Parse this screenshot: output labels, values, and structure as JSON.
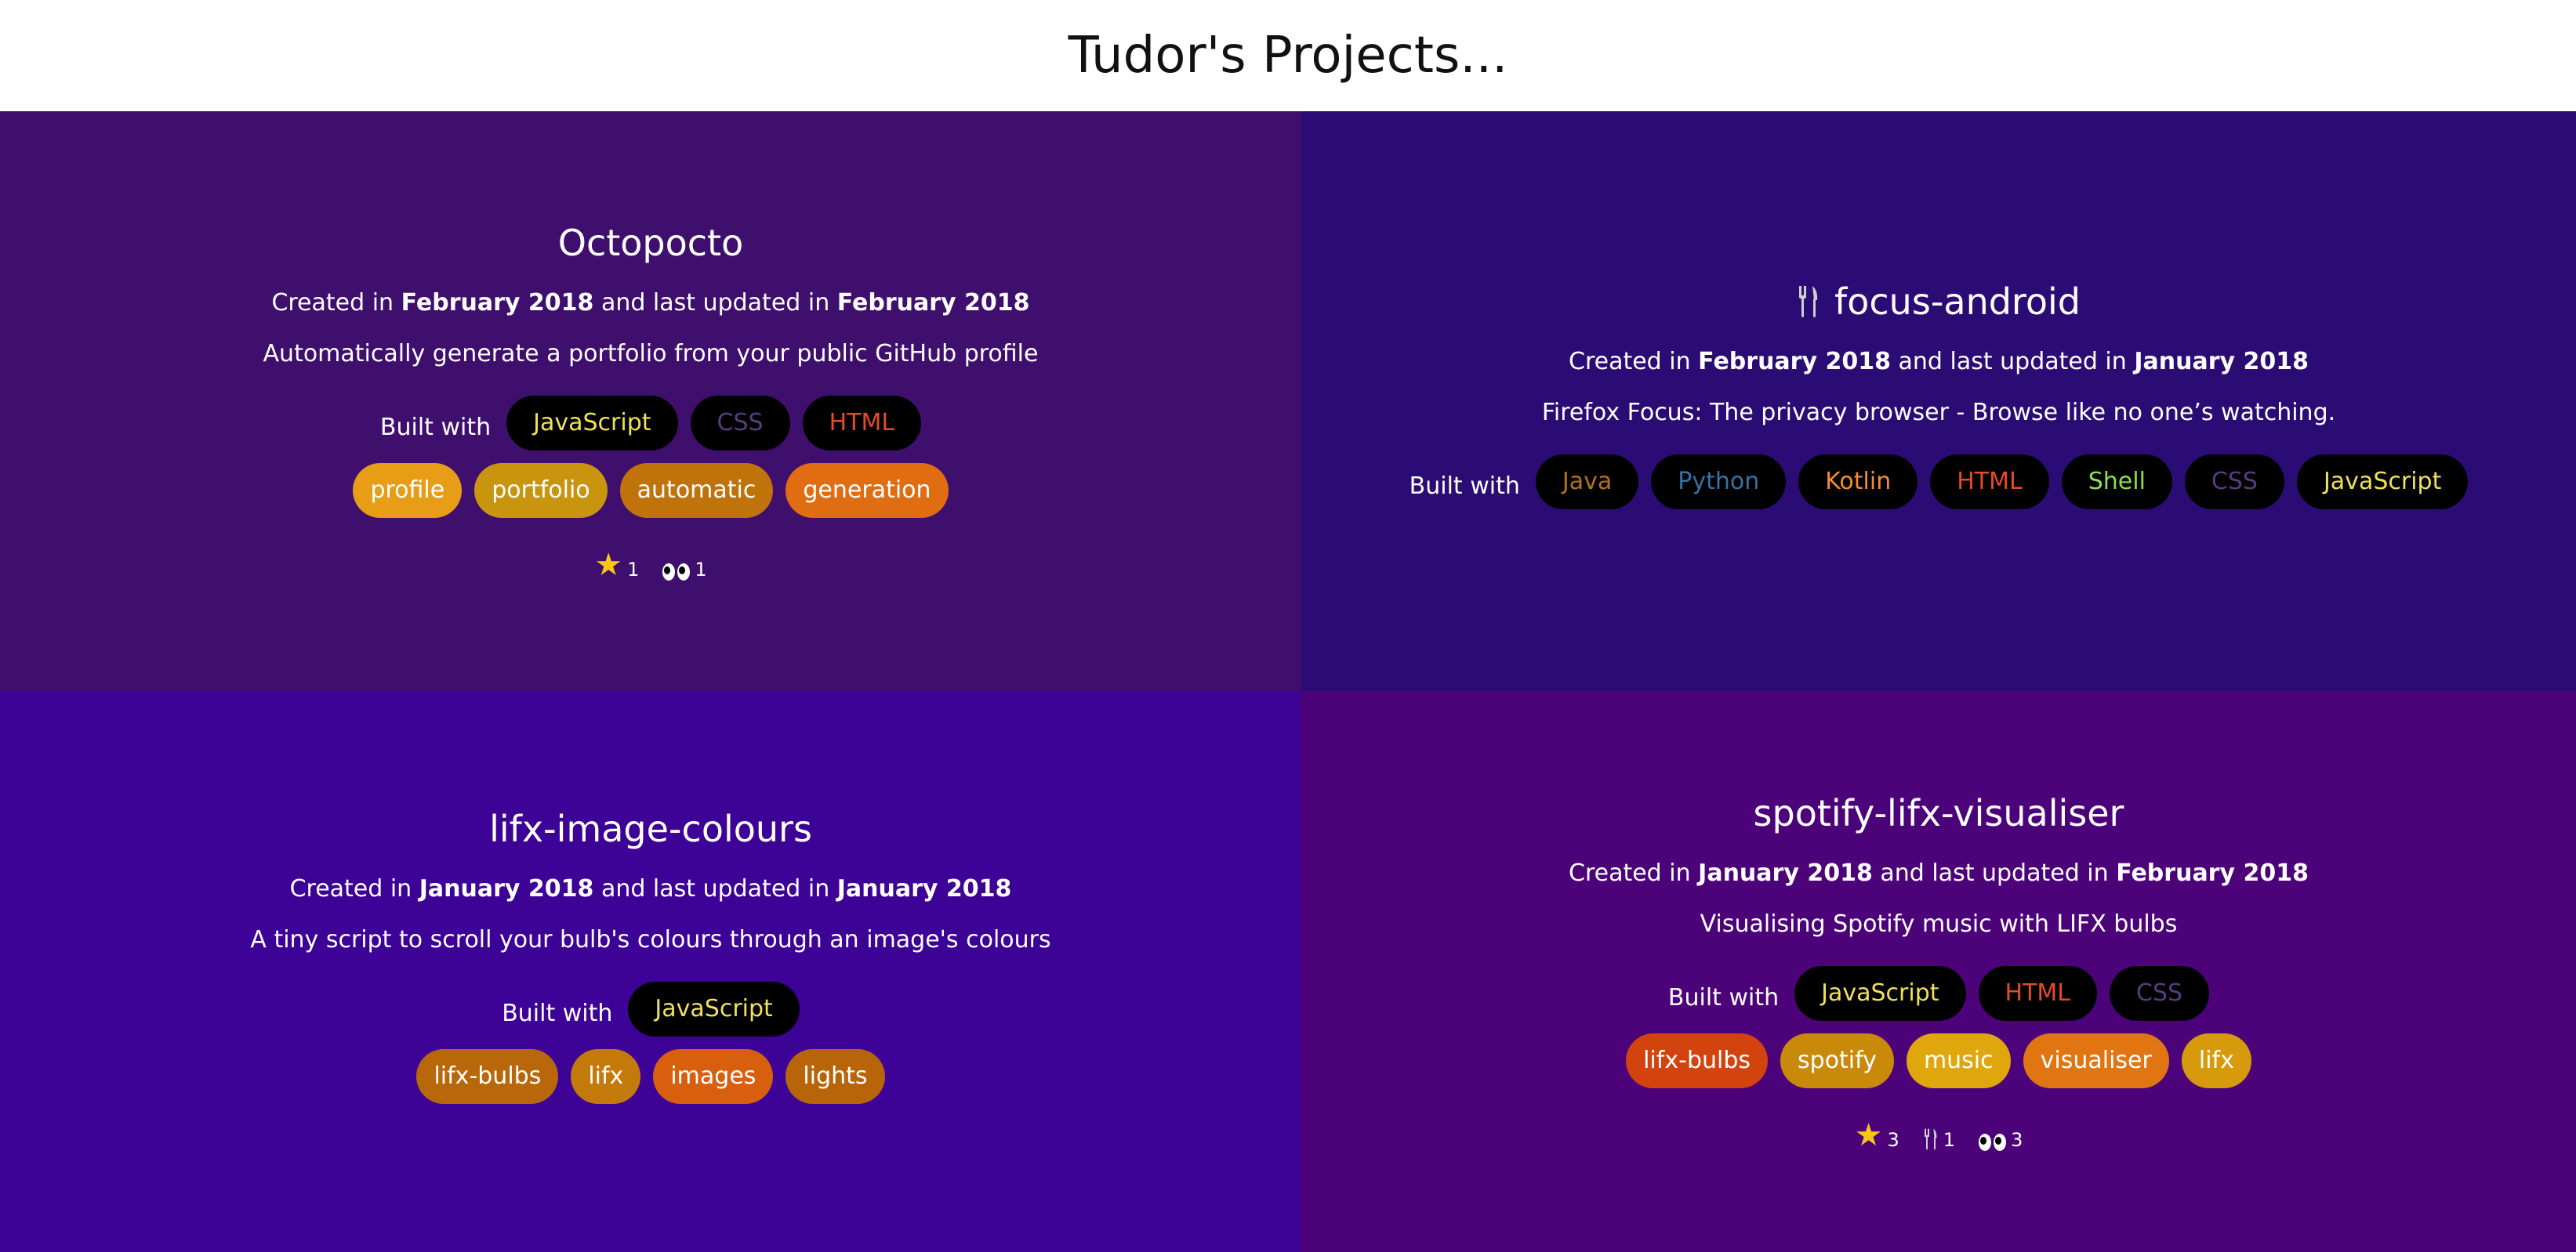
{
  "page": {
    "title": "Tudor's Projects..."
  },
  "built_with_label": "Built with",
  "colors": {
    "card_bg": [
      "#3f0f6e",
      "#2b0c75",
      "#3d0296",
      "#4c037a"
    ]
  },
  "projects": [
    {
      "title": "Octopocto",
      "has_fork_icon": false,
      "created_prefix": "Created in",
      "created": "February 2018",
      "updated_prefix": "and last updated in",
      "updated": "February 2018",
      "description": "Automatically generate a portfolio from your public GitHub profile",
      "languages": [
        {
          "name": "JavaScript",
          "color": "#f1e05a"
        },
        {
          "name": "CSS",
          "color": "#563d7c"
        },
        {
          "name": "HTML",
          "color": "#e34c26"
        }
      ],
      "topics": [
        {
          "name": "profile",
          "bg": "#e89d17"
        },
        {
          "name": "portfolio",
          "bg": "#c9950f"
        },
        {
          "name": "automatic",
          "bg": "#c0720b"
        },
        {
          "name": "generation",
          "bg": "#e06d12"
        }
      ],
      "stats": {
        "stars": "1",
        "forks": null,
        "watchers": "1"
      }
    },
    {
      "title": "focus-android",
      "has_fork_icon": true,
      "created_prefix": "Created in",
      "created": "February 2018",
      "updated_prefix": "and last updated in",
      "updated": "January 2018",
      "description": "Firefox Focus: The privacy browser - Browse like no one’s watching.",
      "languages": [
        {
          "name": "Java",
          "color": "#b07219"
        },
        {
          "name": "Python",
          "color": "#3572A5"
        },
        {
          "name": "Kotlin",
          "color": "#F18E33"
        },
        {
          "name": "HTML",
          "color": "#e34c26"
        },
        {
          "name": "Shell",
          "color": "#89e051"
        },
        {
          "name": "CSS",
          "color": "#563d7c"
        },
        {
          "name": "JavaScript",
          "color": "#f1e05a"
        }
      ],
      "topics": [],
      "stats": null
    },
    {
      "title": "lifx-image-colours",
      "has_fork_icon": false,
      "created_prefix": "Created in",
      "created": "January 2018",
      "updated_prefix": "and last updated in",
      "updated": "January 2018",
      "description": "A tiny script to scroll your bulb's colours through an image's colours",
      "languages": [
        {
          "name": "JavaScript",
          "color": "#f1e05a"
        }
      ],
      "topics": [
        {
          "name": "lifx-bulbs",
          "bg": "#b8680a"
        },
        {
          "name": "lifx",
          "bg": "#c47a0a"
        },
        {
          "name": "images",
          "bg": "#d85f0e"
        },
        {
          "name": "lights",
          "bg": "#b8650a"
        }
      ],
      "stats": null
    },
    {
      "title": "spotify-lifx-visualiser",
      "has_fork_icon": false,
      "created_prefix": "Created in",
      "created": "January 2018",
      "updated_prefix": "and last updated in",
      "updated": "February 2018",
      "description": "Visualising Spotify music with LIFX bulbs",
      "languages": [
        {
          "name": "JavaScript",
          "color": "#f1e05a"
        },
        {
          "name": "HTML",
          "color": "#e34c26"
        },
        {
          "name": "CSS",
          "color": "#563d7c"
        }
      ],
      "topics": [
        {
          "name": "lifx-bulbs",
          "bg": "#d2430e"
        },
        {
          "name": "spotify",
          "bg": "#c98a0a"
        },
        {
          "name": "music",
          "bg": "#dfa70b"
        },
        {
          "name": "visualiser",
          "bg": "#e07512"
        },
        {
          "name": "lifx",
          "bg": "#d69a0c"
        }
      ],
      "stats": {
        "stars": "3",
        "forks": "1",
        "watchers": "3"
      }
    }
  ]
}
